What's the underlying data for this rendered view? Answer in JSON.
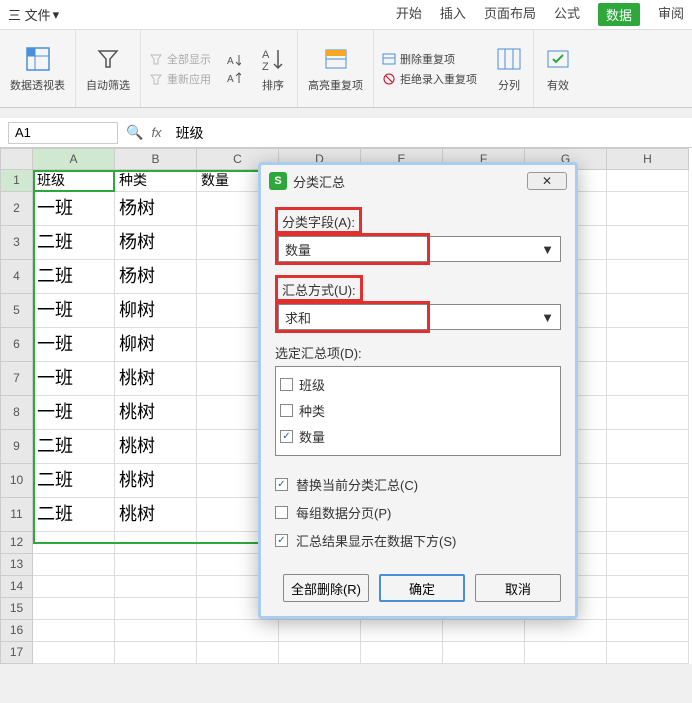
{
  "menubar": {
    "file": "三 文件",
    "tabs": [
      "开始",
      "插入",
      "页面布局",
      "公式",
      "数据",
      "审阅"
    ],
    "active_index": 4
  },
  "ribbon": {
    "pivot": "数据透视表",
    "autofilter": "自动筛选",
    "show_all": "全部显示",
    "reapply": "重新应用",
    "sort_asc": "A↓",
    "sort_desc": "A↓",
    "sort": "排序",
    "highlight_dup": "高亮重复项",
    "remove_dup": "删除重复项",
    "reject_dup": "拒绝录入重复项",
    "split_col": "分列",
    "validation": "有效"
  },
  "formula_bar": {
    "name_box": "A1",
    "formula": "班级"
  },
  "columns": [
    "A",
    "B",
    "C",
    "D",
    "E",
    "F",
    "G",
    "H"
  ],
  "rows": [
    {
      "n": 1,
      "cells": [
        "班级",
        "种类",
        "数量",
        "",
        "",
        "",
        "",
        ""
      ]
    },
    {
      "n": 2,
      "cells": [
        "一班",
        "杨树",
        "",
        "",
        "",
        "",
        "",
        ""
      ]
    },
    {
      "n": 3,
      "cells": [
        "二班",
        "杨树",
        "",
        "",
        "",
        "",
        "",
        ""
      ]
    },
    {
      "n": 4,
      "cells": [
        "二班",
        "杨树",
        "",
        "",
        "",
        "",
        "",
        ""
      ]
    },
    {
      "n": 5,
      "cells": [
        "一班",
        "柳树",
        "",
        "",
        "",
        "",
        "",
        ""
      ]
    },
    {
      "n": 6,
      "cells": [
        "一班",
        "柳树",
        "",
        "",
        "",
        "",
        "",
        ""
      ]
    },
    {
      "n": 7,
      "cells": [
        "一班",
        "桃树",
        "",
        "",
        "",
        "",
        "",
        ""
      ]
    },
    {
      "n": 8,
      "cells": [
        "一班",
        "桃树",
        "",
        "",
        "",
        "",
        "",
        ""
      ]
    },
    {
      "n": 9,
      "cells": [
        "二班",
        "桃树",
        "",
        "",
        "",
        "",
        "",
        ""
      ]
    },
    {
      "n": 10,
      "cells": [
        "二班",
        "桃树",
        "",
        "",
        "",
        "",
        "",
        ""
      ]
    },
    {
      "n": 11,
      "cells": [
        "二班",
        "桃树",
        "",
        "",
        "",
        "",
        "",
        ""
      ]
    },
    {
      "n": 12,
      "cells": [
        "",
        "",
        "",
        "",
        "",
        "",
        "",
        ""
      ]
    },
    {
      "n": 13,
      "cells": [
        "",
        "",
        "",
        "",
        "",
        "",
        "",
        ""
      ]
    },
    {
      "n": 14,
      "cells": [
        "",
        "",
        "",
        "",
        "",
        "",
        "",
        ""
      ]
    },
    {
      "n": 15,
      "cells": [
        "",
        "",
        "",
        "",
        "",
        "",
        "",
        ""
      ]
    },
    {
      "n": 16,
      "cells": [
        "",
        "",
        "",
        "",
        "",
        "",
        "",
        ""
      ]
    },
    {
      "n": 17,
      "cells": [
        "",
        "",
        "",
        "",
        "",
        "",
        "",
        ""
      ]
    }
  ],
  "dialog": {
    "title": "分类汇总",
    "close": "✕",
    "field_label": "分类字段(A):",
    "field_value": "数量",
    "method_label": "汇总方式(U):",
    "method_value": "求和",
    "items_label": "选定汇总项(D):",
    "items": [
      {
        "label": "班级",
        "checked": false
      },
      {
        "label": "种类",
        "checked": false
      },
      {
        "label": "数量",
        "checked": true
      }
    ],
    "options": [
      {
        "label": "替换当前分类汇总(C)",
        "checked": true
      },
      {
        "label": "每组数据分页(P)",
        "checked": false
      },
      {
        "label": "汇总结果显示在数据下方(S)",
        "checked": true
      }
    ],
    "btn_delete_all": "全部删除(R)",
    "btn_ok": "确定",
    "btn_cancel": "取消"
  }
}
